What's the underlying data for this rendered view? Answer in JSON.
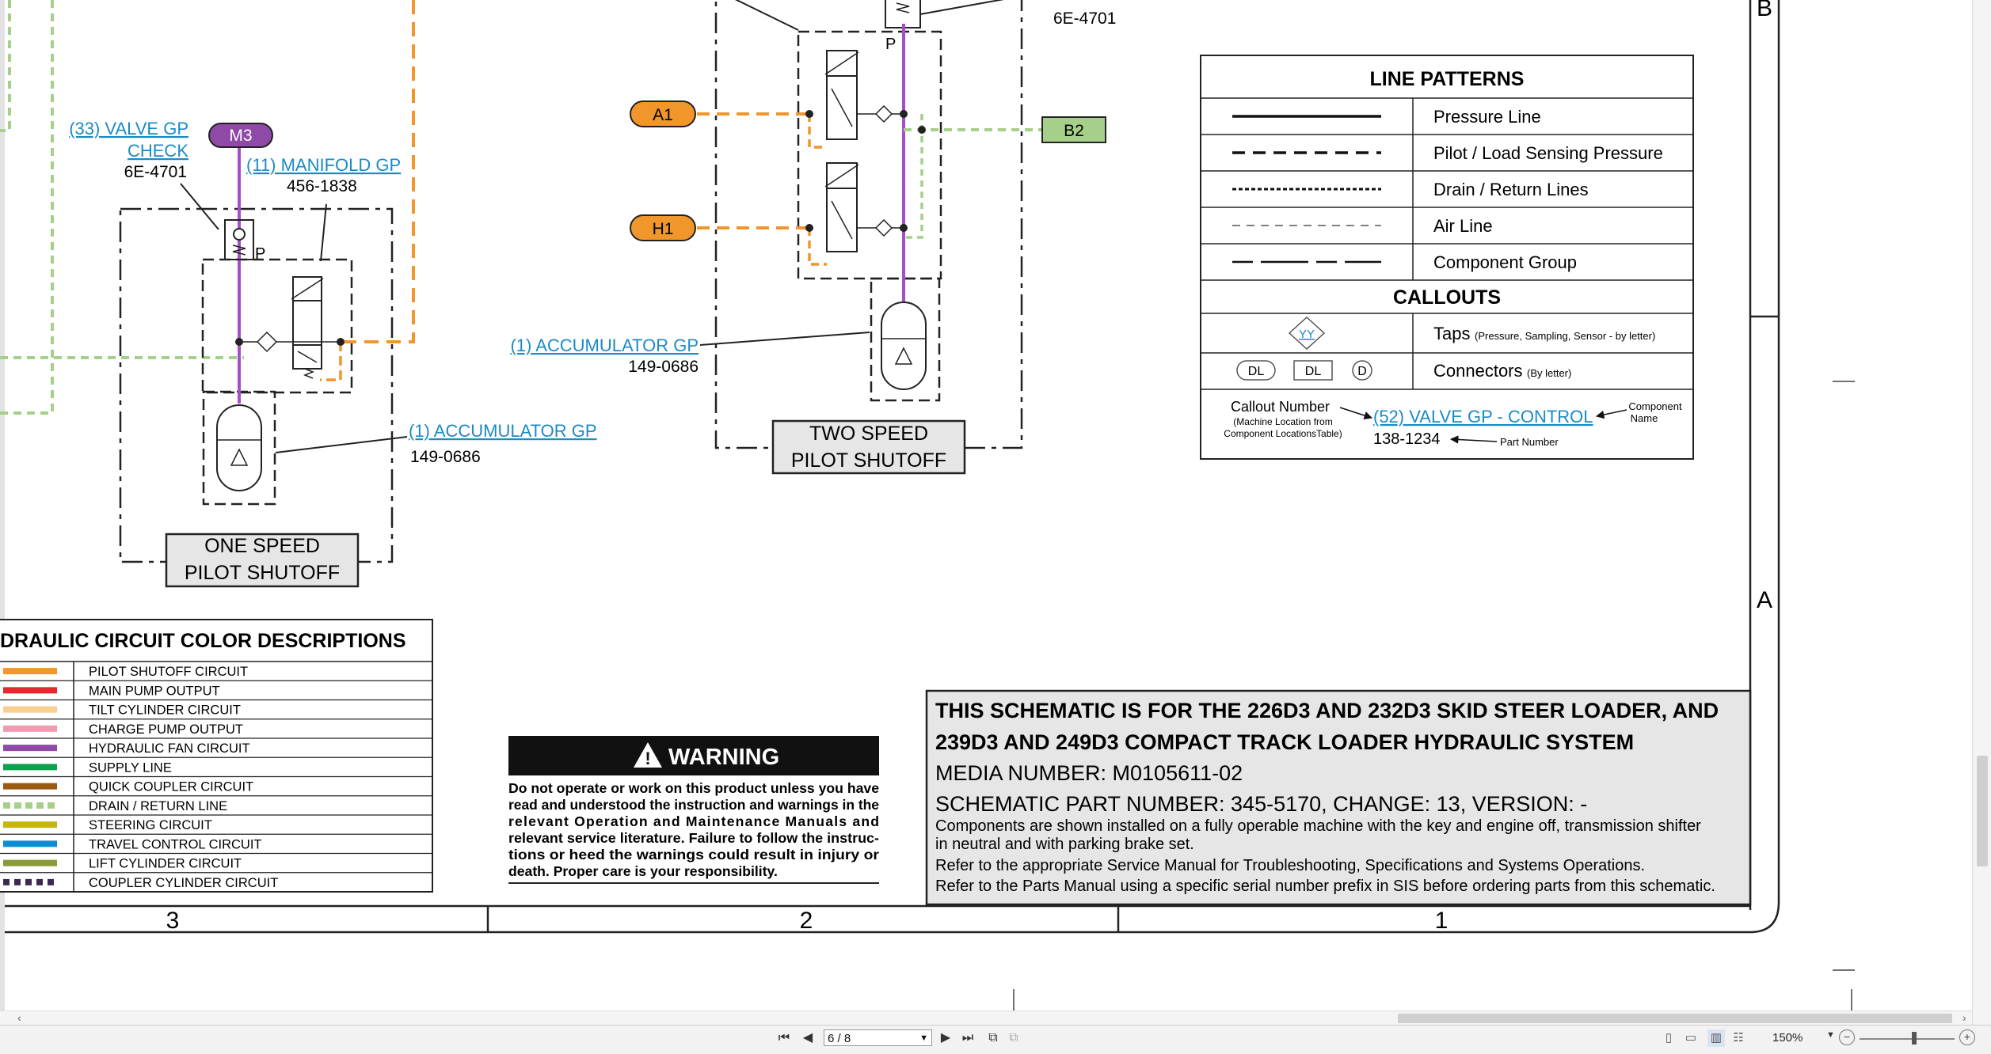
{
  "diagram": {
    "zone_b": "B",
    "zone_a": "A",
    "col_3": "3",
    "col_2": "2",
    "col_1": "1",
    "one_speed": {
      "valve_label_1": "(33) VALVE GP",
      "valve_label_2": "CHECK",
      "valve_part": "6E-4701",
      "manifold_label": "(11) MANIFOLD GP",
      "manifold_part": "456-1838",
      "accumulator_label": "(1) ACCUMULATOR GP",
      "accumulator_part": "149-0686",
      "p_label": "P",
      "m3": "M3",
      "title_1": "ONE SPEED",
      "title_2": "PILOT SHUTOFF"
    },
    "two_speed": {
      "top_part": "6E-4701",
      "accumulator_label": "(1) ACCUMULATOR GP",
      "accumulator_part": "149-0686",
      "p_label": "P",
      "a1": "A1",
      "h1": "H1",
      "b2": "B2",
      "title_1": "TWO SPEED",
      "title_2": "PILOT SHUTOFF"
    },
    "legend": {
      "line_patterns_title": "LINE PATTERNS",
      "pressure": "Pressure Line",
      "pilot": "Pilot / Load Sensing Pressure",
      "drain": "Drain / Return Lines",
      "air": "Air Line",
      "component_group": "Component Group",
      "callouts_title": "CALLOUTS",
      "taps_main": "Taps",
      "taps_note": "(Pressure, Sampling, Sensor - by letter)",
      "tap_symbol": "YY",
      "connectors_main": "Connectors",
      "connectors_note": "(By letter)",
      "conn_dl1": "DL",
      "conn_dl2": "DL",
      "conn_d": "D",
      "callout_number": "Callout Number",
      "callout_note_1": "(Machine Location from",
      "callout_note_2": "Component LocationsTable)",
      "callout_sample": "(52) VALVE GP - CONTROL",
      "component_name_1": "Component",
      "component_name_2": "Name",
      "sample_part": "138-1234",
      "part_number": "Part Number"
    },
    "color_desc": {
      "title": "DRAULIC CIRCUIT COLOR DESCRIPTIONS",
      "rows": [
        {
          "label": "PILOT SHUTOFF CIRCUIT",
          "color": "#f0962a"
        },
        {
          "label": "MAIN PUMP OUTPUT",
          "color": "#e8282e"
        },
        {
          "label": "TILT CYLINDER CIRCUIT",
          "color": "#f8cf8f"
        },
        {
          "label": "CHARGE PUMP OUTPUT",
          "color": "#f49ab0"
        },
        {
          "label": "HYDRAULIC FAN CIRCUIT",
          "color": "#8e4aa6"
        },
        {
          "label": "SUPPLY LINE",
          "color": "#0da24e"
        },
        {
          "label": "QUICK COUPLER CIRCUIT",
          "color": "#9a5a12"
        },
        {
          "label": "DRAIN / RETURN LINE",
          "color": "#a6cf8a"
        },
        {
          "label": "STEERING CIRCUIT",
          "color": "#c9b510"
        },
        {
          "label": "TRAVEL CONTROL CIRCUIT",
          "color": "#0d8ed3"
        },
        {
          "label": "LIFT CYLINDER CIRCUIT",
          "color": "#8c9a3c"
        },
        {
          "label": "COUPLER CYLINDER CIRCUIT",
          "color": "#3a2a50"
        }
      ]
    },
    "warning": {
      "title": "WARNING",
      "lines": [
        "Do not operate or work on this product unless you have",
        "read and understood the instruction and warnings in the",
        "relevant Operation and Maintenance Manuals and",
        "relevant service literature. Failure to follow the instruc-",
        "tions or heed the warnings could result in injury or",
        "death. Proper care is your responsibility."
      ]
    },
    "title_block": {
      "line1": "THIS SCHEMATIC IS FOR THE 226D3 AND 232D3 SKID STEER LOADER, AND",
      "line2": "239D3 AND 249D3 COMPACT TRACK LOADER HYDRAULIC SYSTEM",
      "media": "MEDIA NUMBER: M0105611-02",
      "part": "SCHEMATIC PART NUMBER: 345-5170, CHANGE: 13, VERSION: -",
      "note1": "Components are shown installed on a fully operable machine with the key and engine off, transmission shifter",
      "note1b": "in neutral and with parking brake set.",
      "note2": "Refer to the appropriate Service Manual for Troubleshooting, Specifications and Systems Operations.",
      "note3": "Refer to the Parts Manual using a specific serial number prefix in SIS before ordering parts from this schematic."
    }
  },
  "viewer": {
    "page_value": "6 / 8",
    "zoom": "150%",
    "colors": {
      "link": "#1a8bc7",
      "orange": "#f0962a",
      "green_dash": "#a6cf8a",
      "purple": "#a64ec8"
    }
  }
}
